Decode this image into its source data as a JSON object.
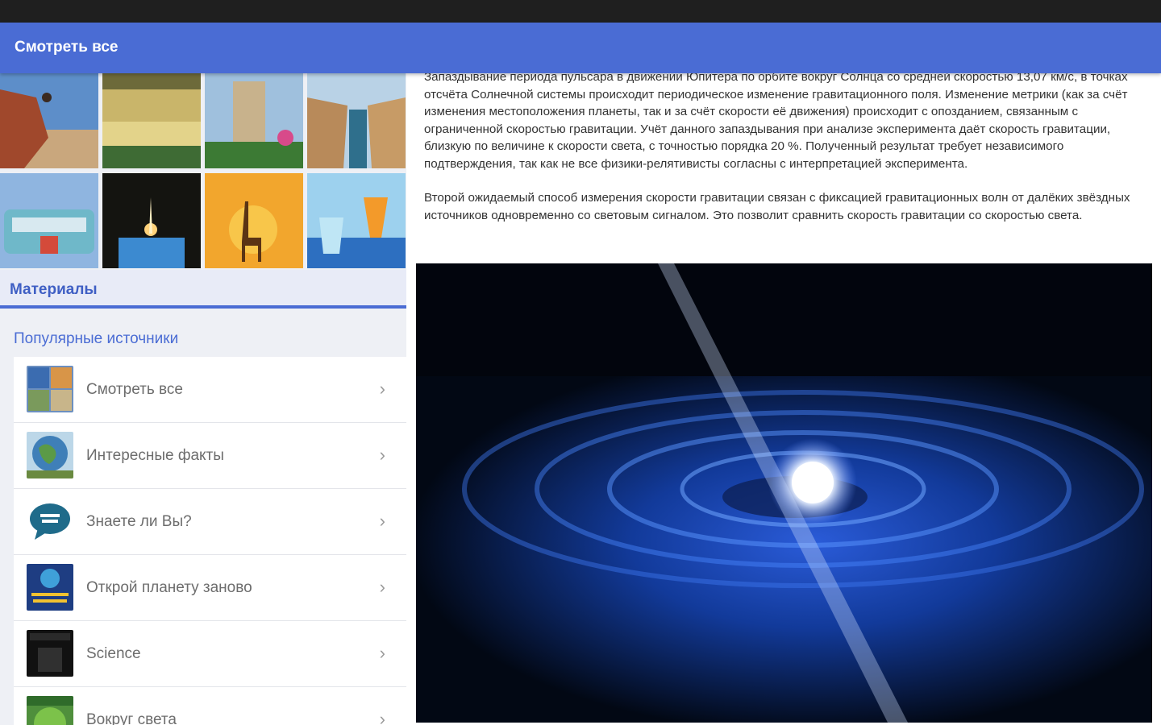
{
  "appbar": {
    "title": "Смотреть все"
  },
  "left": {
    "gallery": [
      {
        "name": "photo-rock-climber"
      },
      {
        "name": "photo-garden-town"
      },
      {
        "name": "photo-monaco-tower"
      },
      {
        "name": "photo-corinth-canal"
      },
      {
        "name": "photo-retro-bus"
      },
      {
        "name": "photo-night-fountain"
      },
      {
        "name": "photo-giraffe-sunset"
      },
      {
        "name": "photo-cocktails"
      }
    ],
    "materials_label": "Материалы",
    "popular_label": "Популярные источники",
    "items": [
      {
        "label": "Смотреть все",
        "icon": "collage-icon"
      },
      {
        "label": "Интересные факты",
        "icon": "globe-icon"
      },
      {
        "label": "Знаете ли Вы?",
        "icon": "speech-bubble-icon"
      },
      {
        "label": "Открой планету заново",
        "icon": "planet-book-icon"
      },
      {
        "label": "Science",
        "icon": "science-magazine-icon"
      },
      {
        "label": "Вокруг света",
        "icon": "world-magazine-icon"
      }
    ]
  },
  "article": {
    "paragraph1": "Запаздывание периода пульсара в движении Юпитера по орбите вокруг Солнца со средней скоростью 13,07 км/с, в точках отсчёта Солнечной системы происходит периодическое изменение гравитационного поля. Изменение метрики (как за счёт изменения местоположения планеты, так и за счёт скорости её движения) происходит с опозданием, связанным с ограниченной скоростью гравитации. Учёт данного запаздывания при анализе эксперимента даёт скорость гравитации, близкую по величине к скорости света, с точностью порядка 20 %. Полученный результат требует независимого подтверждения, так как не все физики-релятивисты согласны с интерпретацией эксперимента.",
    "paragraph2": "Второй ожидаемый способ измерения скорости гравитации связан с фиксацией гравитационных волн от далёких звёздных источников одновременно со световым сигналом. Это позволит сравнить скорость гравитации со скоростью света."
  },
  "colors": {
    "accent": "#4a6cd4",
    "statusbar": "#1f1f1f"
  }
}
